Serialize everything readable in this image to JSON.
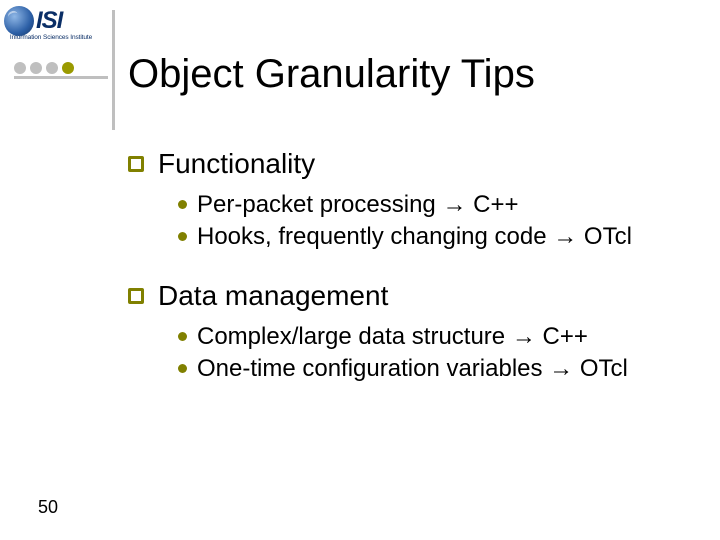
{
  "logo": {
    "letters": "ISI",
    "subtitle": "Information Sciences Institute"
  },
  "title": "Object Granularity Tips",
  "sections": [
    {
      "heading": "Functionality",
      "items": [
        "Per-packet processing → C++",
        "Hooks, frequently changing code → OTcl"
      ]
    },
    {
      "heading": "Data management",
      "items": [
        "Complex/large data structure → C++",
        "One-time configuration variables → OTcl"
      ]
    }
  ],
  "page_number": "50"
}
